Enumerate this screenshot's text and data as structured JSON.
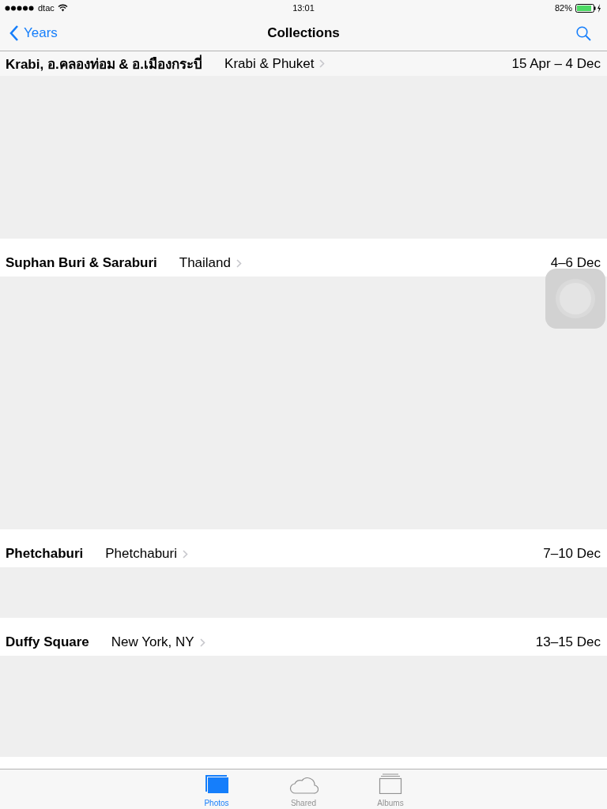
{
  "status_bar": {
    "carrier": "dtac",
    "time": "13:01",
    "battery": "82%"
  },
  "nav": {
    "back": "Years",
    "title": "Collections"
  },
  "collections": [
    {
      "name": "Krabi, อ.คลองท่อม & อ.เมืองกระบี่",
      "place": "Krabi & Phuket",
      "dates": "15 Apr – 4 Dec"
    },
    {
      "name": "Suphan Buri & Saraburi",
      "place": "Thailand",
      "dates": "4–6 Dec"
    },
    {
      "name": "Phetchaburi",
      "place": "Phetchaburi",
      "dates": "7–10 Dec"
    },
    {
      "name": "Duffy Square",
      "place": "New York, NY",
      "dates": "13–15 Dec"
    }
  ],
  "tabs": [
    {
      "label": "Photos",
      "selected": true
    },
    {
      "label": "Shared",
      "selected": false
    },
    {
      "label": "Albums",
      "selected": false
    }
  ]
}
